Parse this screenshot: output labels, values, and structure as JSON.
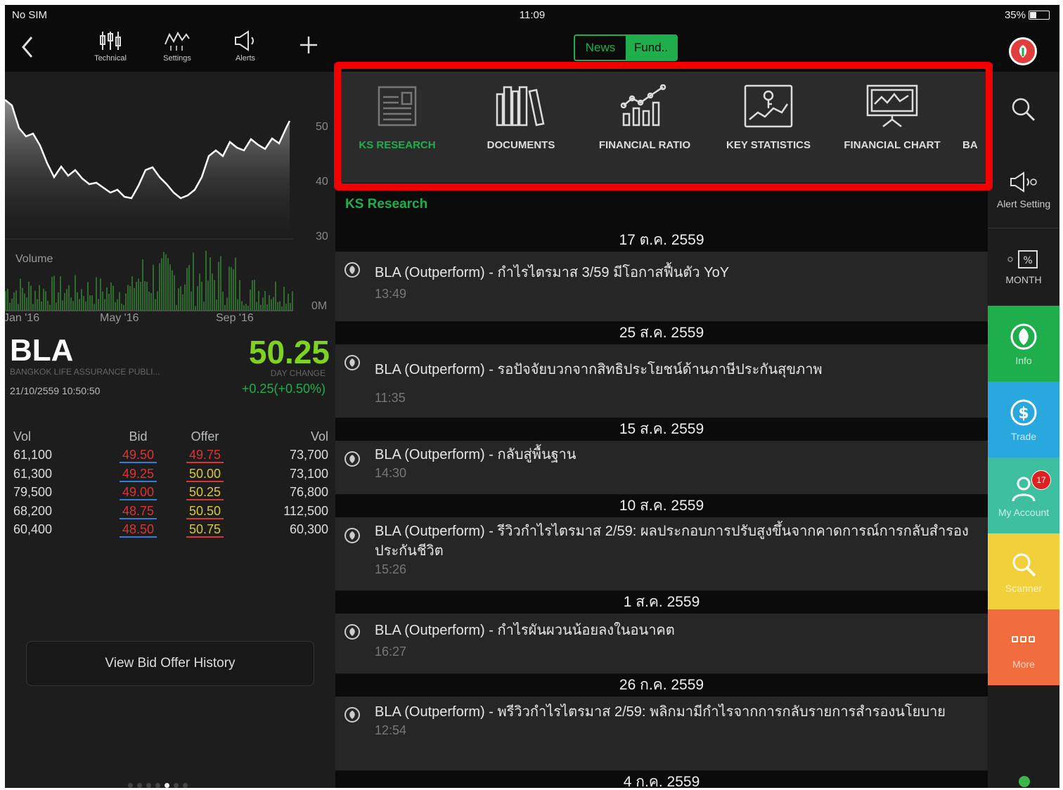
{
  "status_bar": {
    "carrier": "No SIM",
    "time": "11:09",
    "battery": "35%",
    "battery_level": 0.35
  },
  "toolbar": {
    "technical_label": "Technical",
    "settings_label": "Settings",
    "alerts_label": "Alerts",
    "segment_news": "News",
    "segment_fund": "Fund..",
    "active_segment": "Fund.."
  },
  "chart": {
    "y_ticks": [
      "50",
      "40",
      "30",
      "0M"
    ],
    "x_ticks": [
      "Jan '16",
      "May '16",
      "Sep '16"
    ],
    "volume_label": "Volume"
  },
  "quote": {
    "symbol": "BLA",
    "company": "BANGKOK LIFE ASSURANCE PUBLI...",
    "timestamp": "21/10/2559 10:50:50",
    "price": "50.25",
    "day_change_label": "DAY CHANGE",
    "change": "+0.25(+0.50%)",
    "price_color": "#7ed321",
    "change_color": "#1fae4c"
  },
  "order_book": {
    "headers": {
      "vol_bid": "Vol",
      "bid": "Bid",
      "offer": "Offer",
      "vol_offer": "Vol"
    },
    "rows": [
      {
        "vol_bid": "61,100",
        "bid": "49.50",
        "offer": "49.75",
        "vol_offer": "73,700"
      },
      {
        "vol_bid": "61,300",
        "bid": "49.25",
        "offer": "50.00",
        "vol_offer": "73,100"
      },
      {
        "vol_bid": "79,500",
        "bid": "49.00",
        "offer": "50.25",
        "vol_offer": "76,800"
      },
      {
        "vol_bid": "68,200",
        "bid": "48.75",
        "offer": "50.50",
        "vol_offer": "112,500"
      },
      {
        "vol_bid": "60,400",
        "bid": "48.50",
        "offer": "50.75",
        "vol_offer": "60,300"
      }
    ]
  },
  "history_button": "View Bid Offer History",
  "page_indicator": {
    "count": 7,
    "active_index": 4
  },
  "categories": [
    {
      "label": "KS RESEARCH",
      "icon": "research-icon",
      "active": true
    },
    {
      "label": "DOCUMENTS",
      "icon": "documents-icon",
      "active": false
    },
    {
      "label": "FINANCIAL RATIO",
      "icon": "financial-ratio-icon",
      "active": false
    },
    {
      "label": "KEY STATISTICS",
      "icon": "key-statistics-icon",
      "active": false
    },
    {
      "label": "FINANCIAL CHART",
      "icon": "financial-chart-icon",
      "active": false
    },
    {
      "label": "BA",
      "icon": "partial-icon",
      "active": false
    }
  ],
  "section_title": "KS Research",
  "research_feed": [
    {
      "date": "17 ต.ค. 2559",
      "items": [
        {
          "headline": "BLA (Outperform) - กำไรไตรมาส 3/59 มีโอกาสฟื้นตัว YoY",
          "time": "13:49"
        }
      ]
    },
    {
      "date": "25 ส.ค. 2559",
      "items": [
        {
          "headline": "BLA (Outperform) - รอปัจจัยบวกจากสิทธิประโยชน์ด้านภาษีประกันสุขภาพ",
          "time": "11:35"
        }
      ]
    },
    {
      "date": "15 ส.ค. 2559",
      "items": [
        {
          "headline": "BLA (Outperform) - กลับสู่พื้นฐาน",
          "time": "14:30"
        }
      ]
    },
    {
      "date": "10 ส.ค. 2559",
      "items": [
        {
          "headline": "BLA (Outperform) - รีวิวกำไรไตรมาส 2/59: ผลประกอบการปรับสูงขึ้นจากคาดการณ์การกลับสำรองประกันชีวิต",
          "time": "15:26"
        }
      ]
    },
    {
      "date": "1 ส.ค. 2559",
      "items": [
        {
          "headline": "BLA (Outperform) - กำไรผันผวนน้อยลงในอนาคต",
          "time": "16:27"
        }
      ]
    },
    {
      "date": "26 ก.ค. 2559",
      "items": [
        {
          "headline": "BLA (Outperform) - พรีวิวกำไรไตรมาส 2/59: พลิกมามีกำไรจากการกลับรายการสำรองนโยบาย",
          "time": "12:54"
        }
      ]
    },
    {
      "date": "4 ก.ค. 2559",
      "items": []
    }
  ],
  "sidebar": {
    "search_icon": "search-icon",
    "alert_setting": "Alert Setting",
    "month": "MONTH",
    "info": "Info",
    "trade": "Trade",
    "my_account": "My Account",
    "my_account_badge": "17",
    "scanner": "Scanner",
    "more": "More",
    "colors": {
      "info": "#1fae4c",
      "trade": "#29a8e0",
      "account": "#3dbfa0",
      "scanner": "#f2d03b",
      "more": "#f26d3d"
    }
  },
  "highlight_color": "#f20000"
}
